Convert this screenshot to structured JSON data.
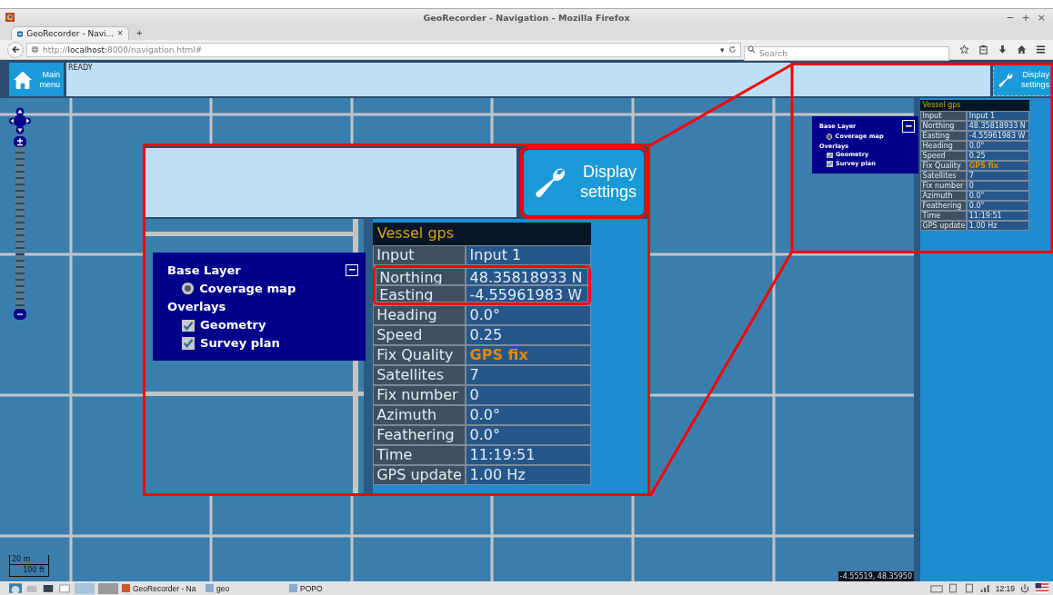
{
  "window": {
    "title": "GeoRecorder - Navigation - Mozilla Firefox",
    "controls": [
      "−",
      "+",
      "×"
    ]
  },
  "tab": {
    "label": "GeoRecorder - Navi...",
    "close": "×",
    "new_tab": "+"
  },
  "nav": {
    "url": "http://**localhost**:8000/navigation.html#",
    "dropdown": "▾",
    "search": {
      "placeholder": "Search"
    }
  },
  "header": {
    "main_menu": "Main menu",
    "status": "READY",
    "display_settings": "Display settings"
  },
  "layers": {
    "title": "Base Layer",
    "base": [
      {
        "label": "Coverage map",
        "selected": true
      }
    ],
    "overlays_title": "Overlays",
    "overlays": [
      {
        "label": "Geometry",
        "checked": true
      },
      {
        "label": "Survey plan",
        "checked": true
      }
    ]
  },
  "vessel_gps": {
    "title": "Vessel gps",
    "rows": [
      {
        "label": "Input",
        "value": "Input 1"
      },
      {
        "label": "Northing",
        "value": "48.35818933 N"
      },
      {
        "label": "Easting",
        "value": "-4.55961983 W"
      },
      {
        "label": "Heading",
        "value": "0.0°"
      },
      {
        "label": "Speed",
        "value": "0.25"
      },
      {
        "label": "Fix Quality",
        "value": "GPS fix",
        "color": "#e08a00"
      },
      {
        "label": "Satellites",
        "value": "7"
      },
      {
        "label": "Fix number",
        "value": "0"
      },
      {
        "label": "Azimuth",
        "value": "0.0°"
      },
      {
        "label": "Feathering",
        "value": "0.0°"
      },
      {
        "label": "Time",
        "value": "11:19:51"
      },
      {
        "label": "GPS update",
        "value": "1.00 Hz"
      }
    ]
  },
  "inset": {
    "display_settings": "Display settings",
    "display_highlighted": true,
    "layers": {
      "title": "Base Layer",
      "base": [
        {
          "label": "Coverage map",
          "selected": true
        }
      ],
      "overlays_title": "Overlays",
      "overlays": [
        {
          "label": "Geometry",
          "checked": true
        },
        {
          "label": "Survey plan",
          "checked": true
        }
      ]
    },
    "vessel_gps": {
      "title": "Vessel gps",
      "rows": [
        {
          "label": "Input",
          "value": "Input 1",
          "highlighted": false
        },
        {
          "label": "Northing",
          "value": "48.35818933 N",
          "highlighted": true
        },
        {
          "label": "Easting",
          "value": "-4.55961983 W",
          "highlighted": true
        },
        {
          "label": "Heading",
          "value": "0.0°",
          "highlighted": false
        },
        {
          "label": "Speed",
          "value": "0.25",
          "highlighted": false
        },
        {
          "label": "Fix Quality",
          "value": "GPS fix",
          "color": "#e08a00",
          "highlighted": false
        },
        {
          "label": "Satellites",
          "value": "7",
          "highlighted": false
        },
        {
          "label": "Fix number",
          "value": "0",
          "highlighted": false
        },
        {
          "label": "Azimuth",
          "value": "0.0°",
          "highlighted": false
        },
        {
          "label": "Feathering",
          "value": "0.0°",
          "highlighted": false
        },
        {
          "label": "Time",
          "value": "11:19:51",
          "highlighted": false
        },
        {
          "label": "GPS update",
          "value": "1.00 Hz",
          "highlighted": false
        }
      ]
    }
  },
  "map": {
    "scale_metric": "20 m",
    "scale_imperial": "100 ft",
    "coordinates": "-4.55519, 48.35950"
  },
  "taskbar": {
    "items": [
      {
        "label": "GeoRecorder - Na"
      },
      {
        "label": "geo"
      },
      {
        "label": "POPO"
      }
    ],
    "clock": "12:19"
  }
}
